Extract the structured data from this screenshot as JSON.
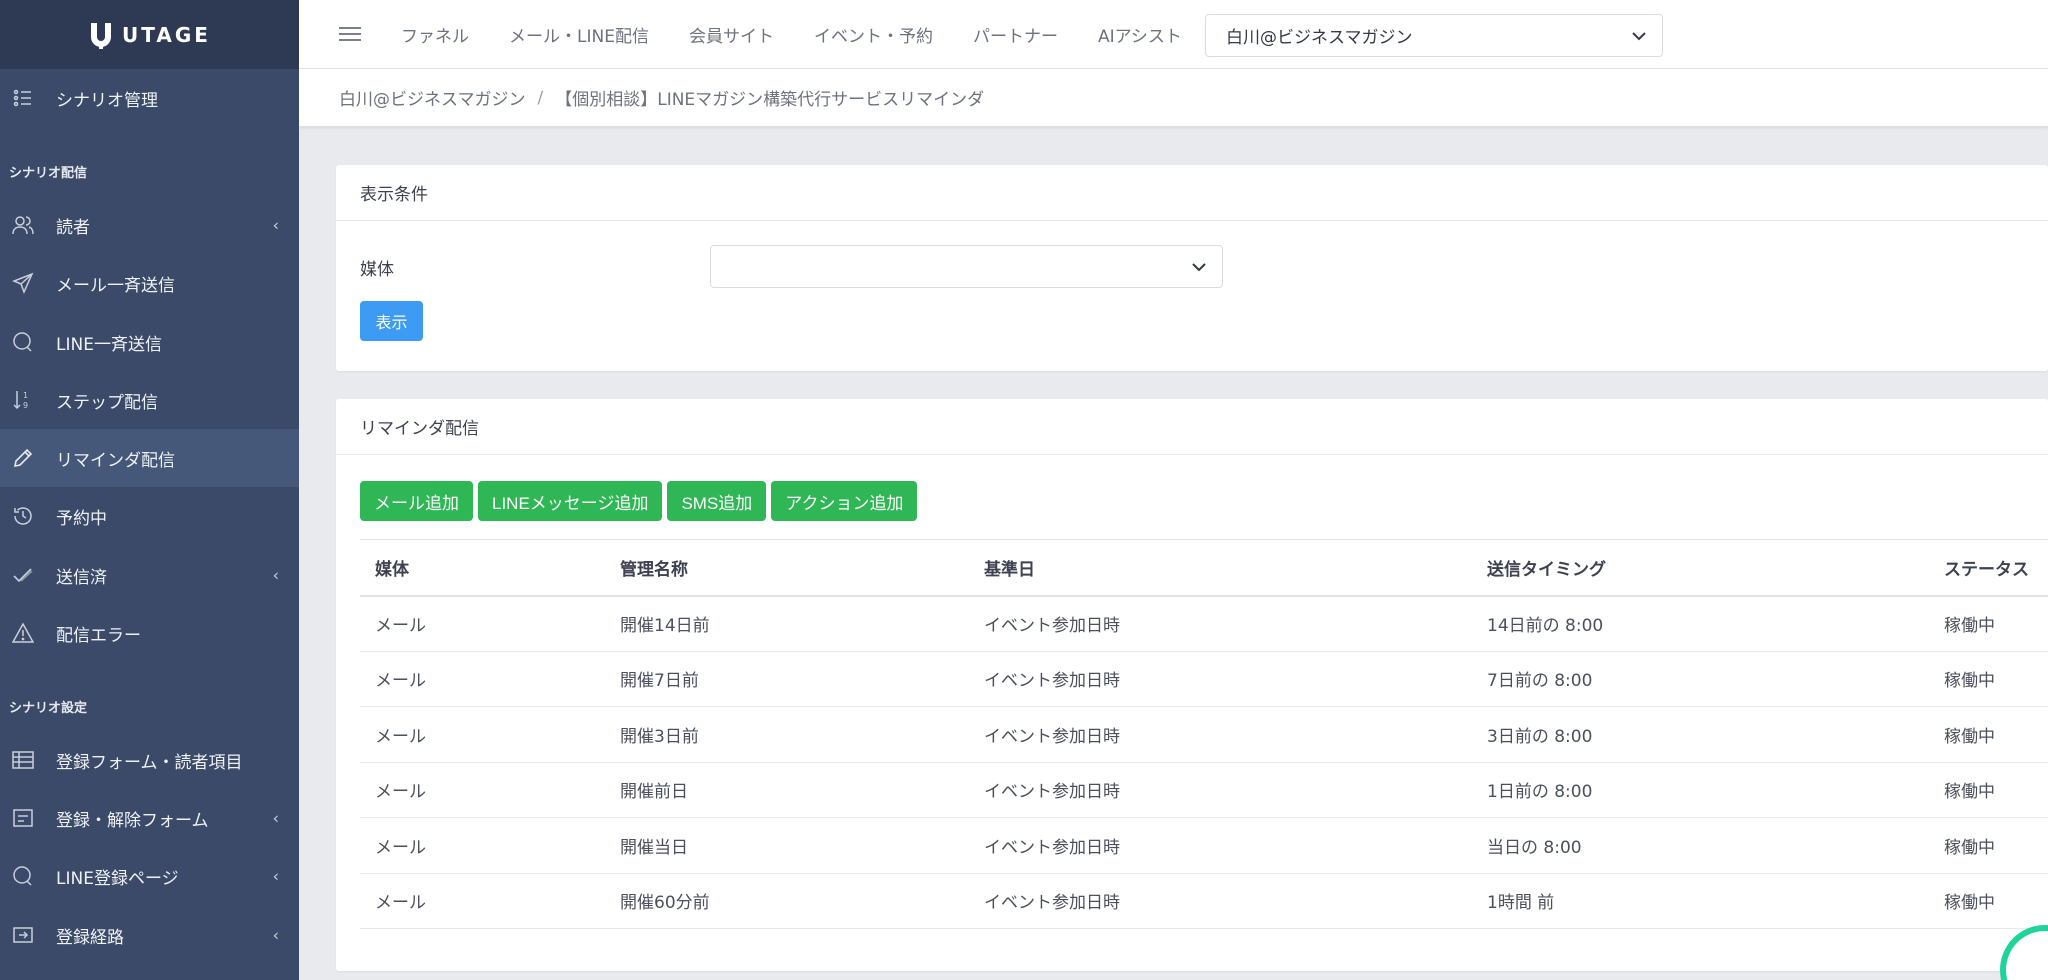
{
  "logo": {
    "text": "UTAGE"
  },
  "sidebar": {
    "top_item": {
      "label": "シナリオ管理",
      "icon": "list-icon"
    },
    "section1": "シナリオ配信",
    "items": [
      {
        "label": "読者",
        "icon": "users-icon",
        "chevron": "‹"
      },
      {
        "label": "メール一斉送信",
        "icon": "send-icon"
      },
      {
        "label": "LINE一斉送信",
        "icon": "chat-icon"
      },
      {
        "label": "ステップ配信",
        "icon": "sort-icon"
      },
      {
        "label": "リマインダ配信",
        "icon": "pencil-icon"
      },
      {
        "label": "予約中",
        "icon": "history-icon"
      },
      {
        "label": "送信済",
        "icon": "check-icon",
        "chevron": "‹"
      },
      {
        "label": "配信エラー",
        "icon": "warning-icon"
      }
    ],
    "section2": "シナリオ設定",
    "items2": [
      {
        "label": "登録フォーム・読者項目",
        "icon": "table-icon"
      },
      {
        "label": "登録・解除フォーム",
        "icon": "form-icon",
        "chevron": "‹"
      },
      {
        "label": "LINE登録ページ",
        "icon": "chat-icon",
        "chevron": "‹"
      },
      {
        "label": "登録経路",
        "icon": "signin-icon",
        "chevron": "‹"
      }
    ]
  },
  "topnav": {
    "items": [
      "ファネル",
      "メール・LINE配信",
      "会員サイト",
      "イベント・予約",
      "パートナー",
      "AIアシスト"
    ],
    "account_select": "白川@ビジネスマガジン"
  },
  "breadcrumb": {
    "parent": "白川@ビジネスマガジン",
    "separator": "/",
    "current": "【個別相談】LINEマガジン構築代行サービスリマインダ"
  },
  "filter_card": {
    "title": "表示条件",
    "label": "媒体",
    "select_value": "",
    "button": "表示"
  },
  "reminder_card": {
    "title": "リマインダ配信",
    "buttons": [
      "メール追加",
      "LINEメッセージ追加",
      "SMS追加",
      "アクション追加"
    ],
    "columns": [
      "媒体",
      "管理名称",
      "基準日",
      "送信タイミング",
      "ステータス"
    ],
    "rows": [
      [
        "メール",
        "開催14日前",
        "イベント参加日時",
        "14日前の 8:00",
        "稼働中"
      ],
      [
        "メール",
        "開催7日前",
        "イベント参加日時",
        "7日前の 8:00",
        "稼働中"
      ],
      [
        "メール",
        "開催3日前",
        "イベント参加日時",
        "3日前の 8:00",
        "稼働中"
      ],
      [
        "メール",
        "開催前日",
        "イベント参加日時",
        "1日前の 8:00",
        "稼働中"
      ],
      [
        "メール",
        "開催当日",
        "イベント参加日時",
        "当日の 8:00",
        "稼働中"
      ],
      [
        "メール",
        "開催60分前",
        "イベント参加日時",
        "1時間 前",
        "稼働中"
      ]
    ]
  },
  "colors": {
    "sidebar": "#3b4a68",
    "primary": "#3d9bf3",
    "success": "#2fb755",
    "accent": "#1fd49a"
  }
}
